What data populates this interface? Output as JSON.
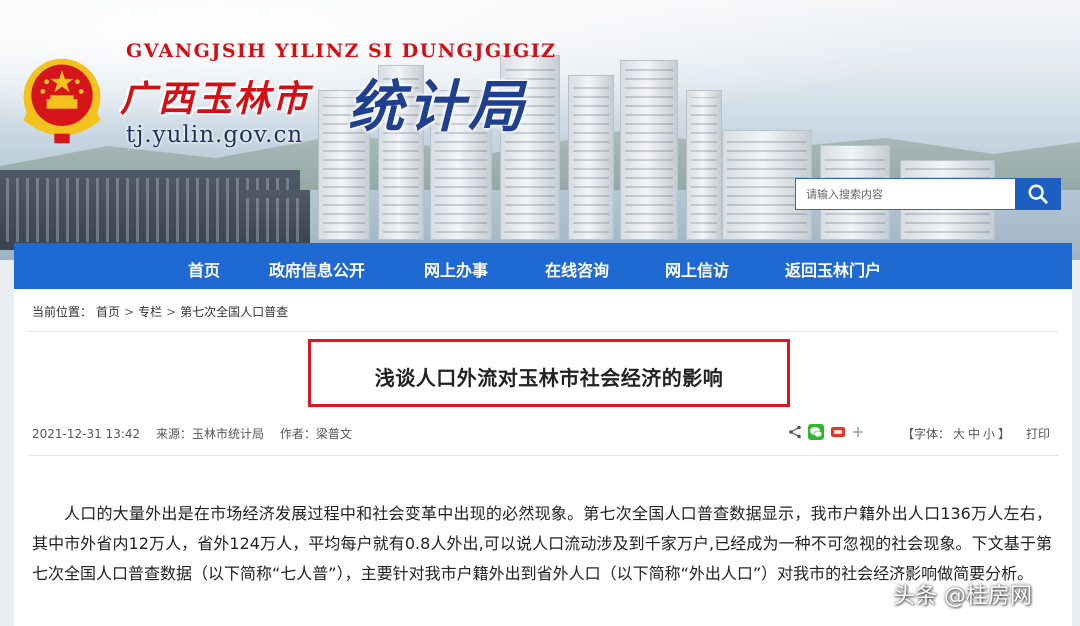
{
  "header": {
    "roman_name": "GVANGJSIH YILINZ SI DUNGJGIGIZ",
    "city_name": "广西玉林市",
    "bureau_name": "统计局",
    "domain": "tj.yulin.gov.cn"
  },
  "search": {
    "placeholder": "请输入搜索内容",
    "icon": "search-icon"
  },
  "nav": {
    "items": [
      "首页",
      "政府信息公开",
      "网上办事",
      "在线咨询",
      "网上信访",
      "返回玉林门户"
    ]
  },
  "breadcrumb": {
    "prefix": "当前位置：",
    "items": [
      "首页",
      "专栏",
      "第七次全国人口普查"
    ],
    "separator": ">"
  },
  "article": {
    "title": "浅谈人口外流对玉林市社会经济的影响",
    "date": "2021-12-31 13:42",
    "source": "来源：玉林市统计局",
    "author": "作者：梁普文",
    "body": "人口的大量外出是在市场经济发展过程中和社会变革中出现的必然现象。第七次全国人口普查数据显示，我市户籍外出人口136万人左右，其中市外省内12万人，省外124万人，平均每户就有0.8人外出,可以说人口流动涉及到千家万户,已经成为一种不可忽视的社会现象。下文基于第七次全国人口普查数据（以下简称“七人普”），主要针对我市户籍外出到省外人口（以下简称“外出人口”）对我市的社会经济影响做简要分析。"
  },
  "toolbar": {
    "share_icons": [
      "share-icon",
      "wechat-icon",
      "weibo-icon",
      "plus-icon"
    ],
    "font_label": "【字体：",
    "font_large": "大",
    "font_medium": "中",
    "font_small": "小",
    "font_end": "】",
    "print": "打印"
  },
  "watermark": "头条 @桂房网",
  "colors": {
    "nav_bg": "#1e69d2",
    "brand_red": "#d40f14",
    "title_border": "#e0161c",
    "bureau_blue": "#1f3f8f"
  }
}
